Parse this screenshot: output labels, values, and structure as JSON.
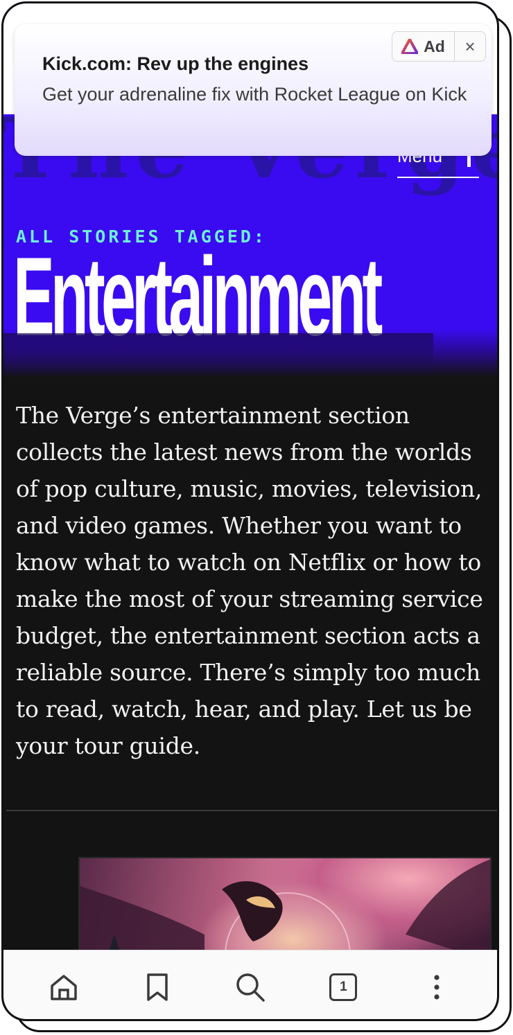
{
  "ad": {
    "badge_label": "Ad",
    "title": "Kick.com: Rev up the engines",
    "body": "Get your adrenaline fix with Rocket League on Kick",
    "close_symbol": "×"
  },
  "site": {
    "logo_text": "The Verge",
    "menu_label": "Menu"
  },
  "section": {
    "tag_label": "ALL STORIES TAGGED:",
    "title": "Entertainment",
    "description": "The Verge’s entertainment section collects the latest news from the worlds of pop culture, music, movies, television, and video games. Whether you want to know what to watch on Netflix or how to make the most of your streaming service budget, the entertainment section acts a reliable source. There’s simply too much to read, watch, hear, and play. Let us be your tour guide."
  },
  "toolbar": {
    "tab_count": "1",
    "icons": [
      "home-icon",
      "bookmark-icon",
      "search-icon",
      "tabs-icon",
      "more-icon"
    ]
  },
  "colors": {
    "hero_purple": "#3a0bf0",
    "tag_mint": "#6ff0d6",
    "background_dark": "#131313"
  }
}
